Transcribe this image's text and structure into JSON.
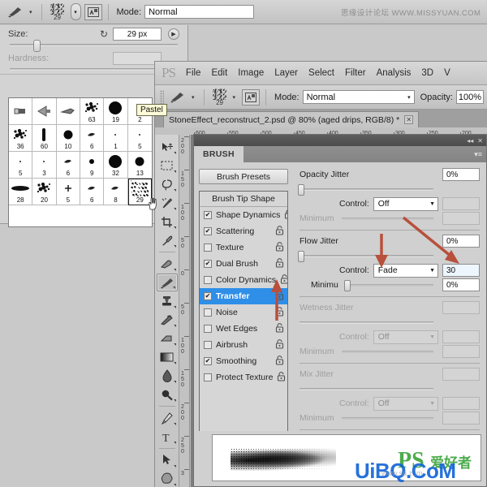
{
  "watermarks": {
    "top": "思缘设计论坛  WWW.MISSYUAN.COM",
    "bottom_blue": "UiBQ.CoM",
    "bottom_green_ps": "PS",
    "bottom_green_cn": "爱好者",
    "bottom_small": "www.sa z .m"
  },
  "back_options_bar": {
    "brush_icon": "brush-icon",
    "caret": "▾",
    "brush_preset_number": "29",
    "pill_caret": "▾",
    "tablet_icon": "tablet-pressure-icon",
    "mode_label": "Mode:",
    "mode_value": "Normal"
  },
  "brush_picker": {
    "size_label": "Size:",
    "size_value": "29 px",
    "reset_icon": "reset-icon",
    "arrow_icon": "▶",
    "hardness_label": "Hardness:",
    "hardness_value": "",
    "tooltip": "Pastel",
    "cursor_icon": "hand-cursor-icon",
    "grid": [
      {
        "label": "",
        "glyph": "flat",
        "selected": false
      },
      {
        "label": "",
        "glyph": "fan",
        "selected": false
      },
      {
        "label": "",
        "glyph": "angle",
        "selected": false
      },
      {
        "label": "63",
        "glyph": "spatter",
        "selected": false
      },
      {
        "label": "19",
        "glyph": "round-l",
        "selected": false
      },
      {
        "label": "2",
        "glyph": "dot-xs",
        "selected": false
      },
      {
        "label": "36",
        "glyph": "spatter",
        "selected": false
      },
      {
        "label": "60",
        "glyph": "bar",
        "selected": false
      },
      {
        "label": "10",
        "glyph": "round-m",
        "selected": false
      },
      {
        "label": "6",
        "glyph": "leaf",
        "selected": false
      },
      {
        "label": "1",
        "glyph": "dot-xs",
        "selected": false
      },
      {
        "label": "5",
        "glyph": "dot-xs",
        "selected": false
      },
      {
        "label": "5",
        "glyph": "dot-xs",
        "selected": false
      },
      {
        "label": "3",
        "glyph": "dot-xs",
        "selected": false
      },
      {
        "label": "6",
        "glyph": "leaf",
        "selected": false
      },
      {
        "label": "9",
        "glyph": "round-s",
        "selected": false
      },
      {
        "label": "32",
        "glyph": "round-l",
        "selected": false
      },
      {
        "label": "13",
        "glyph": "round-m",
        "selected": false
      },
      {
        "label": "28",
        "glyph": "ellipse",
        "selected": false
      },
      {
        "label": "20",
        "glyph": "spatter",
        "selected": false
      },
      {
        "label": "5",
        "glyph": "cross",
        "selected": false
      },
      {
        "label": "6",
        "glyph": "leaf",
        "selected": false
      },
      {
        "label": "8",
        "glyph": "leaf",
        "selected": false
      },
      {
        "label": "29",
        "glyph": "pastel",
        "selected": true
      }
    ]
  },
  "photoshop": {
    "logo": "PS",
    "menus": [
      "File",
      "Edit",
      "Image",
      "Layer",
      "Select",
      "Filter",
      "Analysis",
      "3D",
      "V"
    ],
    "options_bar": {
      "brush_icon": "brush-icon",
      "caret": "▾",
      "brush_preset_number": "29",
      "tablet_icon": "tablet-pressure-icon",
      "mode_label": "Mode:",
      "mode_value": "Normal",
      "opacity_label": "Opacity:",
      "opacity_value": "100%"
    },
    "document_tab": {
      "title": "StoneEffect_reconstruct_2.psd @ 80% (aged drips, RGB/8) *",
      "close_icon": "✕"
    },
    "ruler_h_labels": [
      "600",
      "550",
      "500",
      "450",
      "400",
      "350",
      "300",
      "250",
      "200"
    ],
    "ruler_v_labels": [
      "200",
      "150",
      "100",
      "50",
      "0",
      "50",
      "100",
      "150",
      "200",
      "250",
      "3"
    ],
    "tools": [
      "move-tool-icon",
      "marquee-tool-icon",
      "lasso-tool-icon",
      "magic-wand-tool-icon",
      "crop-tool-icon",
      "eyedropper-tool-icon",
      "healing-brush-tool-icon",
      "brush-tool-icon",
      "clone-stamp-tool-icon",
      "history-brush-tool-icon",
      "eraser-tool-icon",
      "gradient-tool-icon",
      "blur-tool-icon",
      "dodge-tool-icon",
      "pen-tool-icon",
      "type-tool-icon",
      "path-selection-tool-icon",
      "shape-tool-icon"
    ],
    "active_tool": "brush-tool-icon"
  },
  "brush_panel": {
    "titlebar": {
      "collapse_icon": "◂◂",
      "close_icon": "✕"
    },
    "tab_label": "BRUSH",
    "menu_icon": "▾≡",
    "presets_button": "Brush Presets",
    "list_header": "Brush Tip Shape",
    "options": [
      {
        "label": "Shape Dynamics",
        "checked": true,
        "selected": false,
        "lock": "lock-icon"
      },
      {
        "label": "Scattering",
        "checked": true,
        "selected": false,
        "lock": "lock-icon"
      },
      {
        "label": "Texture",
        "checked": false,
        "selected": false,
        "lock": "lock-icon"
      },
      {
        "label": "Dual Brush",
        "checked": true,
        "selected": false,
        "lock": "lock-icon"
      },
      {
        "label": "Color Dynamics",
        "checked": false,
        "selected": false,
        "lock": "lock-icon"
      },
      {
        "label": "Transfer",
        "checked": true,
        "selected": true,
        "lock": "lock-icon"
      },
      {
        "label": "Noise",
        "checked": false,
        "selected": false,
        "lock": "lock-icon"
      },
      {
        "label": "Wet Edges",
        "checked": false,
        "selected": false,
        "lock": "lock-icon"
      },
      {
        "label": "Airbrush",
        "checked": false,
        "selected": false,
        "lock": "lock-icon"
      },
      {
        "label": "Smoothing",
        "checked": true,
        "selected": false,
        "lock": "lock-icon"
      },
      {
        "label": "Protect Texture",
        "checked": false,
        "selected": false,
        "lock": "lock-icon"
      }
    ],
    "settings": {
      "opacity_jitter": {
        "label": "Opacity Jitter",
        "value": "0%",
        "control_label": "Control:",
        "control_value": "Off",
        "control_extra": "",
        "minimum_label": "Minimum",
        "minimum_value": "",
        "disabled": false
      },
      "flow_jitter": {
        "label": "Flow Jitter",
        "value": "0%",
        "control_label": "Control:",
        "control_value": "Fade",
        "control_extra": "30",
        "minimum_label": "Minimu",
        "minimum_value": "0%",
        "disabled": false
      },
      "wetness_jitter": {
        "label": "Wetness Jitter",
        "value": "",
        "control_label": "Control:",
        "control_value": "Off",
        "control_extra": "",
        "minimum_label": "Minimum",
        "minimum_value": "",
        "disabled": true
      },
      "mix_jitter": {
        "label": "Mix Jitter",
        "value": "",
        "control_label": "Control:",
        "control_value": "Off",
        "control_extra": "",
        "minimum_label": "Minimum",
        "minimum_value": "",
        "disabled": true
      }
    },
    "preview": {
      "name": "brush-stroke-preview"
    }
  },
  "annotations": {
    "color": "#b8503c",
    "arrow_transfer": "arrow-pointing-to-transfer",
    "arrow_fade": "arrow-pointing-to-fade-control",
    "arrow_value": "arrow-pointing-to-fade-value"
  }
}
